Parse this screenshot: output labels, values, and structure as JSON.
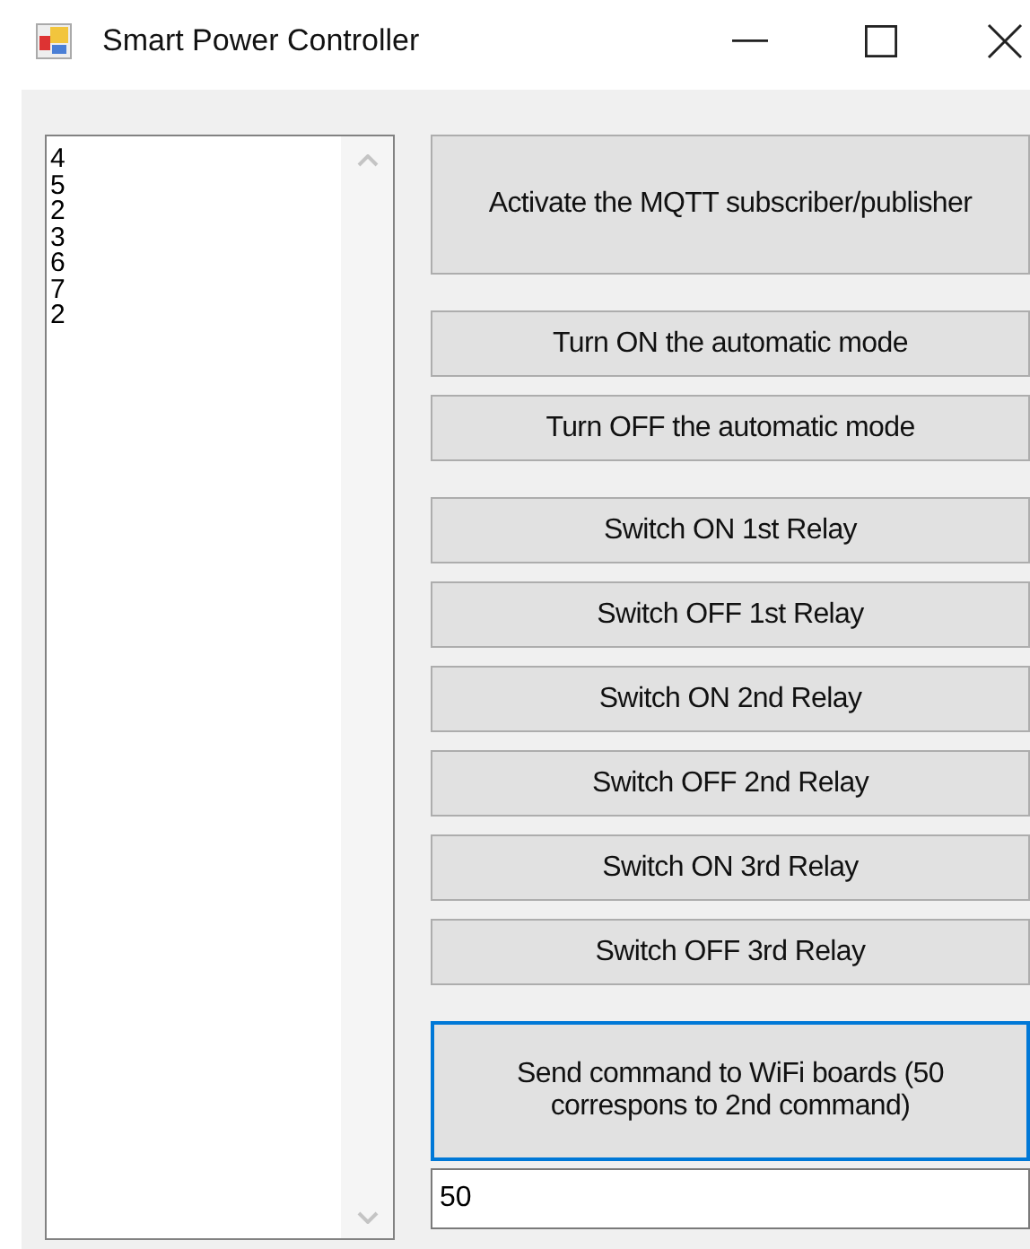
{
  "window": {
    "title": "Smart Power Controller"
  },
  "list": {
    "items": [
      "4",
      "5",
      "2",
      "3",
      "6",
      "7",
      "2"
    ]
  },
  "button_groups": [
    [
      {
        "label": "Activate the MQTT subscriber/publisher",
        "kind": "tall",
        "focused": false
      }
    ],
    [
      {
        "label": "Turn ON the automatic mode",
        "kind": "normal",
        "focused": false
      },
      {
        "label": "Turn OFF the automatic mode",
        "kind": "normal",
        "focused": false
      }
    ],
    [
      {
        "label": "Switch ON 1st Relay",
        "kind": "normal",
        "focused": false
      },
      {
        "label": "Switch OFF 1st Relay",
        "kind": "normal",
        "focused": false
      },
      {
        "label": "Switch ON 2nd Relay",
        "kind": "normal",
        "focused": false
      },
      {
        "label": "Switch OFF 2nd Relay",
        "kind": "normal",
        "focused": false
      },
      {
        "label": "Switch ON 3rd Relay",
        "kind": "normal",
        "focused": false
      },
      {
        "label": "Switch OFF 3rd Relay",
        "kind": "normal",
        "focused": false
      }
    ],
    [
      {
        "label": "Send command to WiFi boards (50 correspons to 2nd command)",
        "kind": "tall",
        "focused": true
      }
    ]
  ],
  "command_field": {
    "value": "50"
  }
}
